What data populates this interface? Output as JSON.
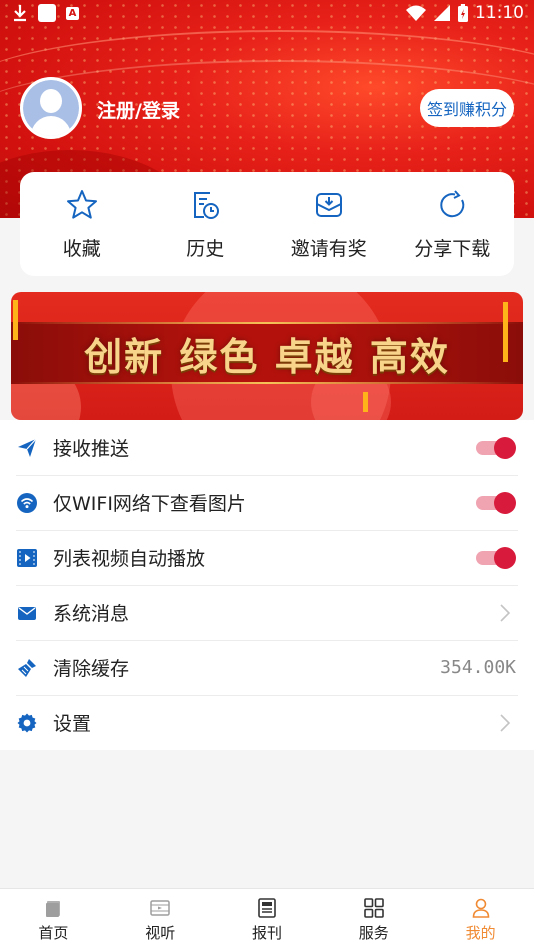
{
  "status_bar": {
    "time": "11:10"
  },
  "profile": {
    "login_label": "注册/登录",
    "checkin_label": "签到赚积分"
  },
  "quick_actions": [
    {
      "label": "收藏",
      "icon": "star-icon"
    },
    {
      "label": "历史",
      "icon": "history-icon"
    },
    {
      "label": "邀请有奖",
      "icon": "invite-icon"
    },
    {
      "label": "分享下载",
      "icon": "share-icon"
    }
  ],
  "banner": {
    "slogan": "创新 绿色 卓越 高效"
  },
  "settings": [
    {
      "label": "接收推送",
      "icon": "send-icon",
      "control": "toggle",
      "on": true
    },
    {
      "label": "仅WIFI网络下查看图片",
      "icon": "wifi-icon",
      "control": "toggle",
      "on": true
    },
    {
      "label": "列表视频自动播放",
      "icon": "video-icon",
      "control": "toggle",
      "on": true
    },
    {
      "label": "系统消息",
      "icon": "mail-icon",
      "control": "chevron"
    },
    {
      "label": "清除缓存",
      "icon": "broom-icon",
      "control": "value",
      "value": "354.00K"
    },
    {
      "label": "设置",
      "icon": "gear-icon",
      "control": "chevron"
    }
  ],
  "tabs": [
    {
      "label": "首页",
      "icon": "home-icon",
      "active": false
    },
    {
      "label": "视听",
      "icon": "film-icon",
      "active": false
    },
    {
      "label": "报刊",
      "icon": "newspaper-icon",
      "active": false
    },
    {
      "label": "服务",
      "icon": "grid-icon",
      "active": false
    },
    {
      "label": "我的",
      "icon": "user-icon",
      "active": true
    }
  ],
  "colors": {
    "accent_blue": "#1565c0",
    "toggle_on": "#d81b3c",
    "tab_active": "#f08a33",
    "hero_red": "#d4120f"
  }
}
